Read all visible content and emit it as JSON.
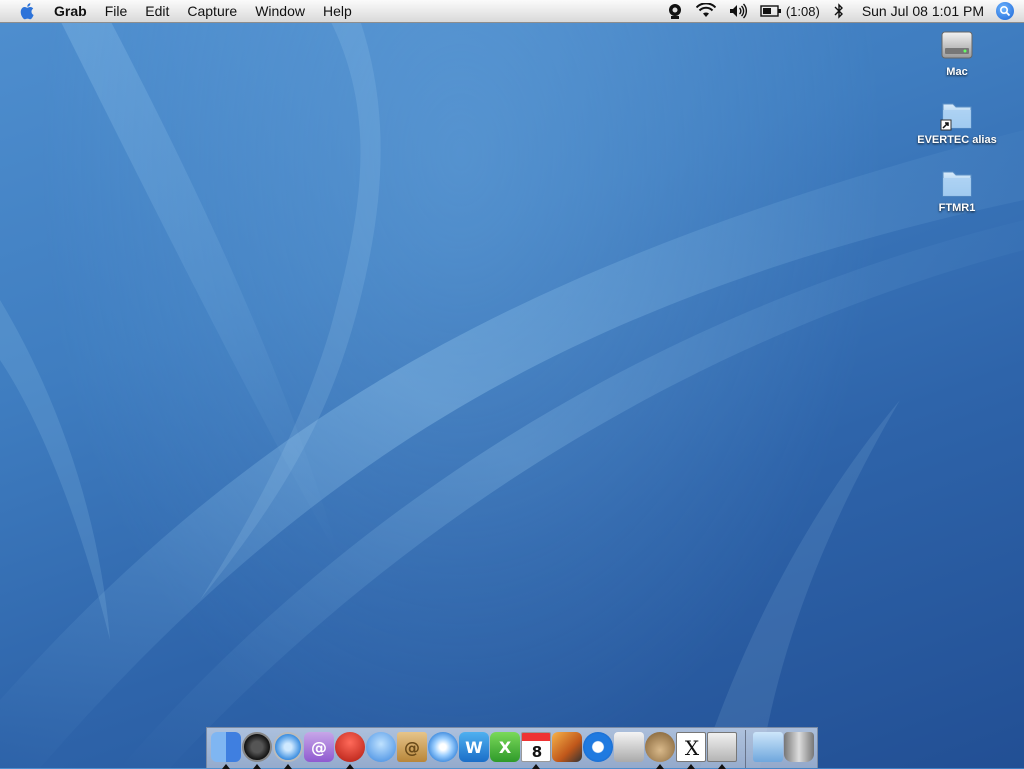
{
  "menubar": {
    "app_name": "Grab",
    "menus": [
      "File",
      "Edit",
      "Capture",
      "Window",
      "Help"
    ],
    "battery_text": "(1:08)",
    "clock": "Sun Jul 08  1:01 PM",
    "status_icons": [
      "webcam-icon",
      "wifi-icon",
      "volume-icon",
      "battery-icon",
      "bluetooth-icon",
      "spotlight-icon"
    ]
  },
  "desktop": {
    "icons": [
      {
        "label": "Mac",
        "icon": "hard-drive-icon"
      },
      {
        "label": "EVERTEC alias",
        "icon": "folder-alias-icon"
      },
      {
        "label": "FTMR1",
        "icon": "folder-icon"
      }
    ]
  },
  "dock": {
    "apps": [
      {
        "name": "finder-icon",
        "running": true
      },
      {
        "name": "dashboard-icon",
        "running": true
      },
      {
        "name": "safari-icon",
        "running": true
      },
      {
        "name": "mail-icon",
        "running": false
      },
      {
        "name": "adium-icon",
        "running": true
      },
      {
        "name": "ichat-icon",
        "running": false
      },
      {
        "name": "address-book-icon",
        "running": false
      },
      {
        "name": "itunes-icon",
        "running": false
      },
      {
        "name": "word-icon",
        "running": false
      },
      {
        "name": "excel-icon",
        "running": false
      },
      {
        "name": "ical-icon",
        "running": true
      },
      {
        "name": "iphoto-icon",
        "running": false
      },
      {
        "name": "quicktime-icon",
        "running": false
      },
      {
        "name": "system-preferences-icon",
        "running": false
      },
      {
        "name": "gimp-icon",
        "running": true
      },
      {
        "name": "x11-icon",
        "running": true
      },
      {
        "name": "grab-icon",
        "running": true
      },
      {
        "name": "applications-folder-icon",
        "running": false
      },
      {
        "name": "trash-icon",
        "running": false
      }
    ],
    "ical_date": "8",
    "x11_letter": "X"
  },
  "colors": {
    "desktop_blue": "#3f7dc0",
    "menubar_bg": "#ececec"
  }
}
